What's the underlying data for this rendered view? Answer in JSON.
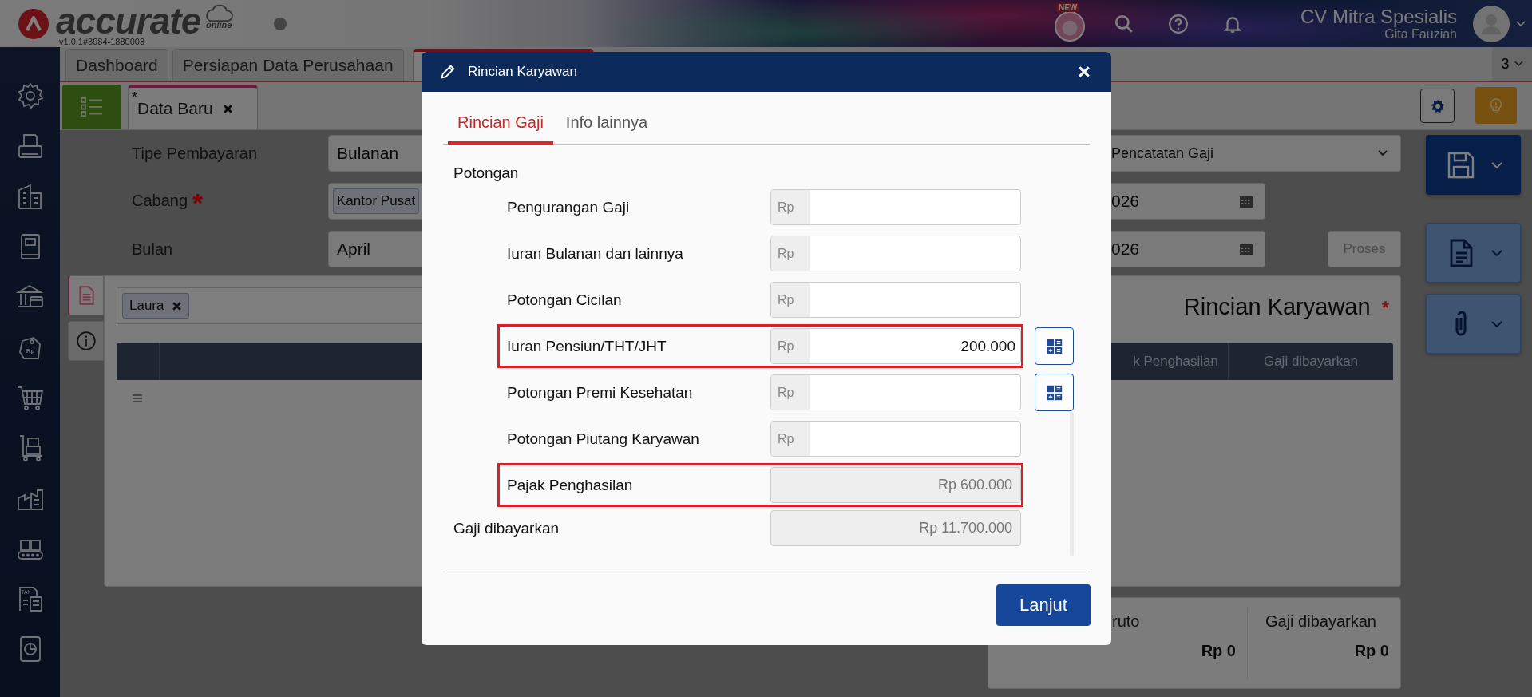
{
  "header": {
    "wordmark": "accurate",
    "cloud_label": "online",
    "version": "v1.0.1#3984-1880003",
    "new_badge": "NEW",
    "company": "CV Mitra Spesialis",
    "user": "Gita Fauziah"
  },
  "sidebar": [
    {
      "kind": "gear"
    },
    {
      "kind": "fax"
    },
    {
      "kind": "building"
    },
    {
      "kind": "book"
    },
    {
      "kind": "bank"
    },
    {
      "kind": "tag",
      "text": "Rp"
    },
    {
      "kind": "cart"
    },
    {
      "kind": "trolley"
    },
    {
      "kind": "factory"
    },
    {
      "kind": "conveyor"
    },
    {
      "kind": "tax",
      "text": "TAX"
    },
    {
      "kind": "report"
    }
  ],
  "tabs": [
    {
      "label": "Dashboard",
      "selected": false
    },
    {
      "label": "Persiapan Data Perusahaan",
      "selected": false
    },
    {
      "selected": true
    }
  ],
  "tab_count": "3",
  "doc_tab": {
    "mark": "*",
    "label": "Data Baru"
  },
  "form": {
    "rows": [
      {
        "label": "Tipe Pembayaran",
        "value": "Bulanan"
      },
      {
        "label": "Cabang",
        "required_mark": "*",
        "chip": "Kantor Pusat"
      },
      {
        "label": "Bulan",
        "value": "April"
      }
    ],
    "right": [
      {
        "kind": "select",
        "value": "Pencatatan Gaji"
      },
      {
        "kind": "date",
        "value": "026"
      },
      {
        "kind": "date",
        "value": "026"
      }
    ],
    "process_button": {
      "label": "Proses",
      "disabled": true
    }
  },
  "panel": {
    "side_tabs": [
      {
        "kind": "document",
        "selected": true
      },
      {
        "kind": "info",
        "selected": false
      }
    ],
    "employee_chips": [
      {
        "label": "Laura"
      }
    ],
    "title": "Rincian Karyawan",
    "title_required_mark": "*",
    "table_columns": [
      "k Penghasilan",
      "Gaji dibayarkan"
    ]
  },
  "summary": [
    {
      "label": "ruto",
      "value": "Rp 0"
    },
    {
      "label": "Gaji dibayarkan",
      "value": "Rp 0"
    }
  ],
  "dialog": {
    "title": "Rincian Karyawan",
    "tabs": [
      {
        "label": "Rincian Gaji",
        "selected": true
      },
      {
        "label": "Info lainnya",
        "selected": false
      }
    ],
    "section": "Potongan",
    "rows": [
      {
        "kind": "amount",
        "label": "Pengurangan Gaji",
        "prefix": "Rp",
        "highlighted": false,
        "calculator": false
      },
      {
        "kind": "amount",
        "label": "Iuran Bulanan dan lainnya",
        "prefix": "Rp",
        "highlighted": false,
        "calculator": false
      },
      {
        "kind": "amount",
        "label": "Potongan Cicilan",
        "prefix": "Rp",
        "highlighted": false,
        "calculator": false
      },
      {
        "kind": "amount",
        "label": "Iuran Pensiun/THT/JHT",
        "prefix": "Rp",
        "value": "200.000",
        "highlighted": true,
        "calculator": true
      },
      {
        "kind": "amount",
        "label": "Potongan Premi Kesehatan",
        "prefix": "Rp",
        "highlighted": false,
        "calculator": true
      },
      {
        "kind": "amount",
        "label": "Potongan Piutang Karyawan",
        "prefix": "Rp",
        "highlighted": false,
        "calculator": false
      },
      {
        "kind": "readonly",
        "label": "Pajak Penghasilan",
        "value": "Rp 600.000",
        "highlighted": true,
        "calculator": false
      }
    ],
    "total": {
      "label": "Gaji dibayarkan",
      "value": "Rp 11.700.000"
    },
    "submit": "Lanjut"
  }
}
